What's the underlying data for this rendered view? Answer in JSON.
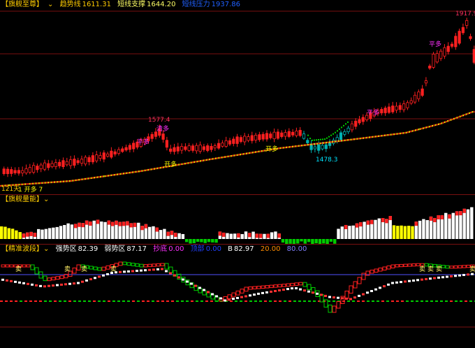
{
  "colors": {
    "up": "#ff2020",
    "down": "#00b3b3",
    "ma": "#ffcc00",
    "frame": "#7a1010",
    "yellow": "#ffff00",
    "white": "#ffffff",
    "green": "#00cc00",
    "magenta": "#ff00ff",
    "cyan": "#00e5ff"
  },
  "panel1": {
    "name": "【旗舰至尊】",
    "dropdown_icon": "chevron-down-icon",
    "trend_label": "趋势线",
    "trend_value": "1611.31",
    "short_support_label": "短线支撑",
    "short_support_value": "1644.20",
    "pressure_label": "短线压力",
    "pressure_value": "1937.86",
    "annotations": {
      "high_left": "1577.4",
      "low_mid": "1478.3",
      "high_right": "1917.9",
      "lbl_a": "平多",
      "lbl_b": "清多",
      "lbl_c": "开多",
      "lbl_d": "开多",
      "lbl_e": "开多",
      "lbl_f": "平多",
      "lbl_g": "平多",
      "days": "121天",
      "small": "1 开多 7"
    }
  },
  "panel2": {
    "name": "【旗舰量能】",
    "dropdown_icon": "chevron-down-icon"
  },
  "panel3": {
    "name": "【精准波段】",
    "dropdown_icon": "chevron-down-icon",
    "strong_label": "强势区",
    "strong_value": "82.39",
    "weak_label": "弱势区",
    "weak_value": "87.17",
    "sell_label": "抄底",
    "sell_value": "0.00",
    "bottom_label": "顶部",
    "bottom_value": "0.00",
    "b_label": "B",
    "b_value": "82.97",
    "v20": "20.00",
    "v80": "80.00",
    "mark_up": "卖",
    "mark_dn": "买"
  }
}
